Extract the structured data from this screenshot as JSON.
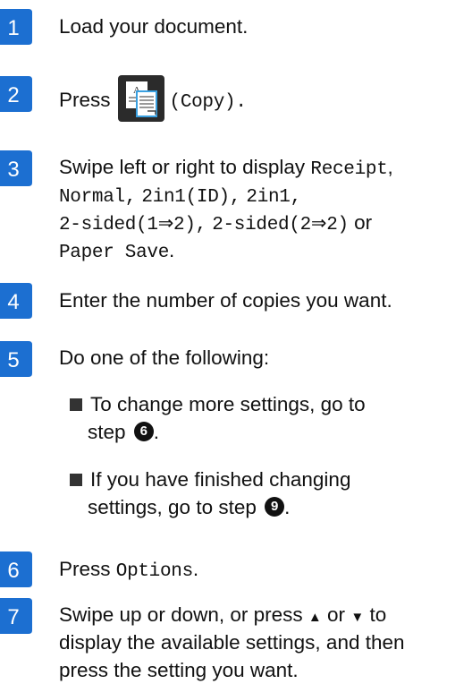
{
  "accent_color": "#1c6fd1",
  "steps": [
    {
      "number": "1",
      "text": "Load your document."
    },
    {
      "number": "2",
      "press": "Press",
      "copy_label": "(Copy)."
    },
    {
      "number": "3",
      "line1_prefix": "Swipe left or right to display ",
      "receipt": "Receipt",
      "normal": "Normal",
      "id": "2in1(ID)",
      "two_in_one": "2in1",
      "sided1": "2-sided(1⇒2)",
      "sided2": "2-sided(2⇒2)",
      "or": "or",
      "paper_save": "Paper Save",
      "comma": ",",
      "period": "."
    },
    {
      "number": "4",
      "text": "Enter the number of copies you want."
    },
    {
      "number": "5",
      "text": "Do one of the following:",
      "bullets": [
        {
          "line1": "To change more settings, go to",
          "line2_prefix": "step",
          "ref": "6",
          "suffix": "."
        },
        {
          "line1": "If you have finished changing",
          "line2_prefix": "settings, go to step",
          "ref": "9",
          "suffix": "."
        }
      ]
    },
    {
      "number": "6",
      "press": "Press",
      "options": "Options",
      "period": "."
    },
    {
      "number": "7",
      "line1_prefix": "Swipe up or down, or press",
      "up_symbol": "▲",
      "or": "or",
      "down_symbol": "▼",
      "line1_suffix": "to",
      "line2": "display the available settings, and then",
      "line3": "press the setting you want."
    }
  ],
  "icons": {
    "copy_button": "copy-icon",
    "bullet": "square-bullet-icon"
  }
}
